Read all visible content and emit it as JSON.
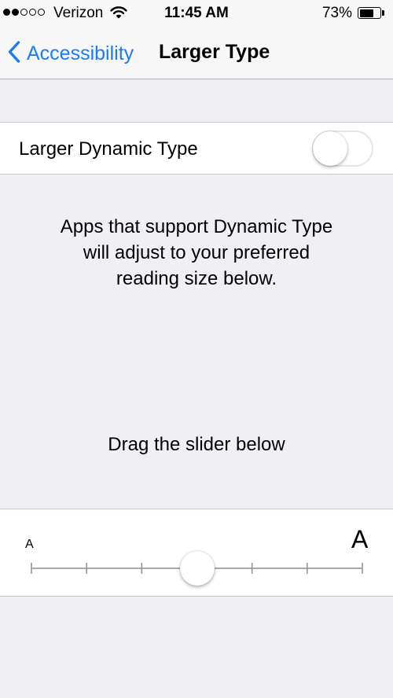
{
  "status_bar": {
    "signal_strength": 2,
    "signal_max": 5,
    "carrier": "Verizon",
    "network_icon": "wifi-icon",
    "time": "11:45 AM",
    "battery_percent": "73%",
    "battery_level": 0.73
  },
  "nav": {
    "back_label": "Accessibility",
    "back_icon": "chevron-left-icon",
    "title": "Larger Type",
    "accent_color": "#1a7cf5"
  },
  "larger_dynamic_type": {
    "label": "Larger Dynamic Type",
    "enabled": false
  },
  "description": {
    "lines": [
      "Apps that support Dynamic Type",
      "will adjust to your preferred",
      "reading size below."
    ]
  },
  "hint": "Drag the slider below",
  "text_size_slider": {
    "min_label": "A",
    "max_label": "A",
    "step_count": 7,
    "selected_step": 4
  }
}
